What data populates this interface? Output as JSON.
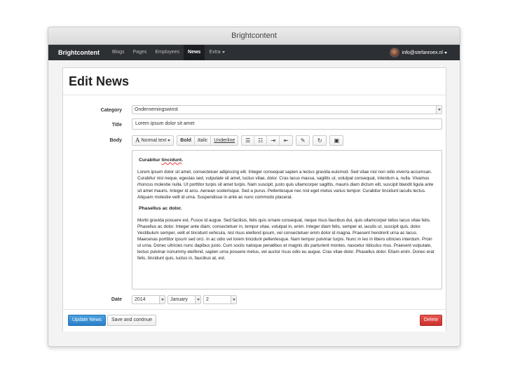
{
  "window": {
    "title": "Brightcontent"
  },
  "navbar": {
    "brand": "Brightcontent",
    "items": [
      {
        "label": "Blogs"
      },
      {
        "label": "Pages"
      },
      {
        "label": "Employees"
      },
      {
        "label": "News",
        "active": true
      },
      {
        "label": "Extra"
      }
    ],
    "user_email": "info@stefanroex.nl"
  },
  "page": {
    "title": "Edit News"
  },
  "form": {
    "category_label": "Category",
    "category_value": "Ondernemingswinst",
    "title_label": "Title",
    "title_value": "Lorem ipsum dolor sit amet",
    "body_label": "Body",
    "date_label": "Date",
    "date": {
      "year": "2014",
      "month": "January",
      "day": "2"
    }
  },
  "toolbar": {
    "font_label": "Normal text",
    "bold": "Bold",
    "italic": "Italic",
    "underline": "Underline"
  },
  "editor": {
    "heading1_before": "Curabitur ",
    "heading1_spell": "tincidunt",
    "heading1_after": ".",
    "para1": "Lorem ipsum dolor sit amet, consectetuer adipiscing elit. Integer consequat sapien a lectus gravida euismod. Sed vitae nisl non odio viverra accumsan. Curabitur nisl neque, egestas sed, vulputate sit amet, luctus vitae, dolor. Cras lacus massa, sagittis ut, volutpat consequat, interdum a, nulla. Vivamus rhoncus molestie nulla. Ut porttitor turpis sit amet turpis. Nam suscipit, justo quis ullamcorper sagittis, mauris diam dictum elit, suscipit blandit ligula ante sit amet mauris. Integer id arcu. Aenean scelerisque. Sed a purus. Pellentesque nec nisl eget metus varius tempor. Curabitur tincidunt iaculis lectus. Aliquam molestie velit id urna. Suspendisse in ante ac nunc commodo placerat.",
    "heading2": "Phasellus ac dolor.",
    "para2": "Morbi gravida posuere est. Fusce id augue. Sed facilisis, felis quis ornare consequat, neque risus faucibus dui, quis ullamcorper tellus lacus vitae felis. Phasellus ac dolor. Integer ante diam, consectetuer in, tempor vitae, volutpat in, enim. Integer diam felis, semper at, iaculis ut, suscipit quis, dolor. Vestibulum semper, velit et tincidunt vehicula, nisl risus eleifend ipsum, vel consectetuer enim dolor id magna. Praesent hendrerit urna ac lacus. Maecenas porttitor ipsum sed orci. In ac odio vel lorem tincidunt pellentesque. Nam tempor pulvinar turpis. Nunc in leo in libero ultricies interdum. Proin ut urna. Donec ultricies nunc dapibus justo. Cum sociis natoque penatibus et magnis dis parturient montes, nascetur ridiculus mus. Praesent vulputate, lectus pulvinar nonummy eleifend, sapien urna posuere metus, vel auctor risus odio eu augue. Cras vitae dolor. Phasellus dolor. Etiam enim. Donec erat felis, tincidunt quis, luctus in, faucibus at, est."
  },
  "actions": {
    "update": "Update News",
    "save_continue": "Save and continue",
    "delete": "Delete"
  },
  "colors": {
    "navbar": "#2c2f33",
    "primary": "#2a7fc8",
    "danger": "#c9302c"
  }
}
